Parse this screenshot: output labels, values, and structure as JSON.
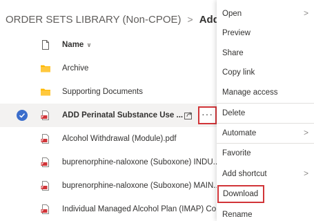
{
  "breadcrumb": {
    "root": "ORDER SETS LIBRARY (Non-CPOE)",
    "separator": ">",
    "current": "Addiction"
  },
  "list": {
    "header": {
      "name_label": "Name",
      "sort_glyph": "∨"
    },
    "rows": [
      {
        "type": "folder",
        "name": "Archive"
      },
      {
        "type": "folder",
        "name": "Supporting Documents"
      },
      {
        "type": "pdf",
        "name": "ADD Perinatal Substance Use ...",
        "selected": true
      },
      {
        "type": "pdf",
        "name": "Alcohol Withdrawal (Module).pdf"
      },
      {
        "type": "pdf",
        "name": "buprenorphine-naloxone (Suboxone) INDU..."
      },
      {
        "type": "pdf",
        "name": "buprenorphine-naloxone (Suboxone) MAIN..."
      },
      {
        "type": "pdf",
        "name": "Individual Managed Alcohol Plan (IMAP) Co..."
      }
    ],
    "more_label": "···"
  },
  "context_menu": {
    "items": [
      {
        "label": "Open",
        "submenu": true
      },
      {
        "label": "Preview"
      },
      {
        "label": "Share"
      },
      {
        "label": "Copy link"
      },
      {
        "label": "Manage access"
      },
      {
        "label": "Delete"
      },
      {
        "label": "Automate",
        "submenu": true
      },
      {
        "label": "Favorite"
      },
      {
        "label": "Add shortcut",
        "submenu": true
      },
      {
        "label": "Download",
        "highlighted": true
      },
      {
        "label": "Rename"
      }
    ],
    "submenu_glyph": ">"
  },
  "colors": {
    "folder": "#ffb900",
    "pdf": "#d13438",
    "selection": "#3b6ecc",
    "highlight_border": "#d13438"
  }
}
